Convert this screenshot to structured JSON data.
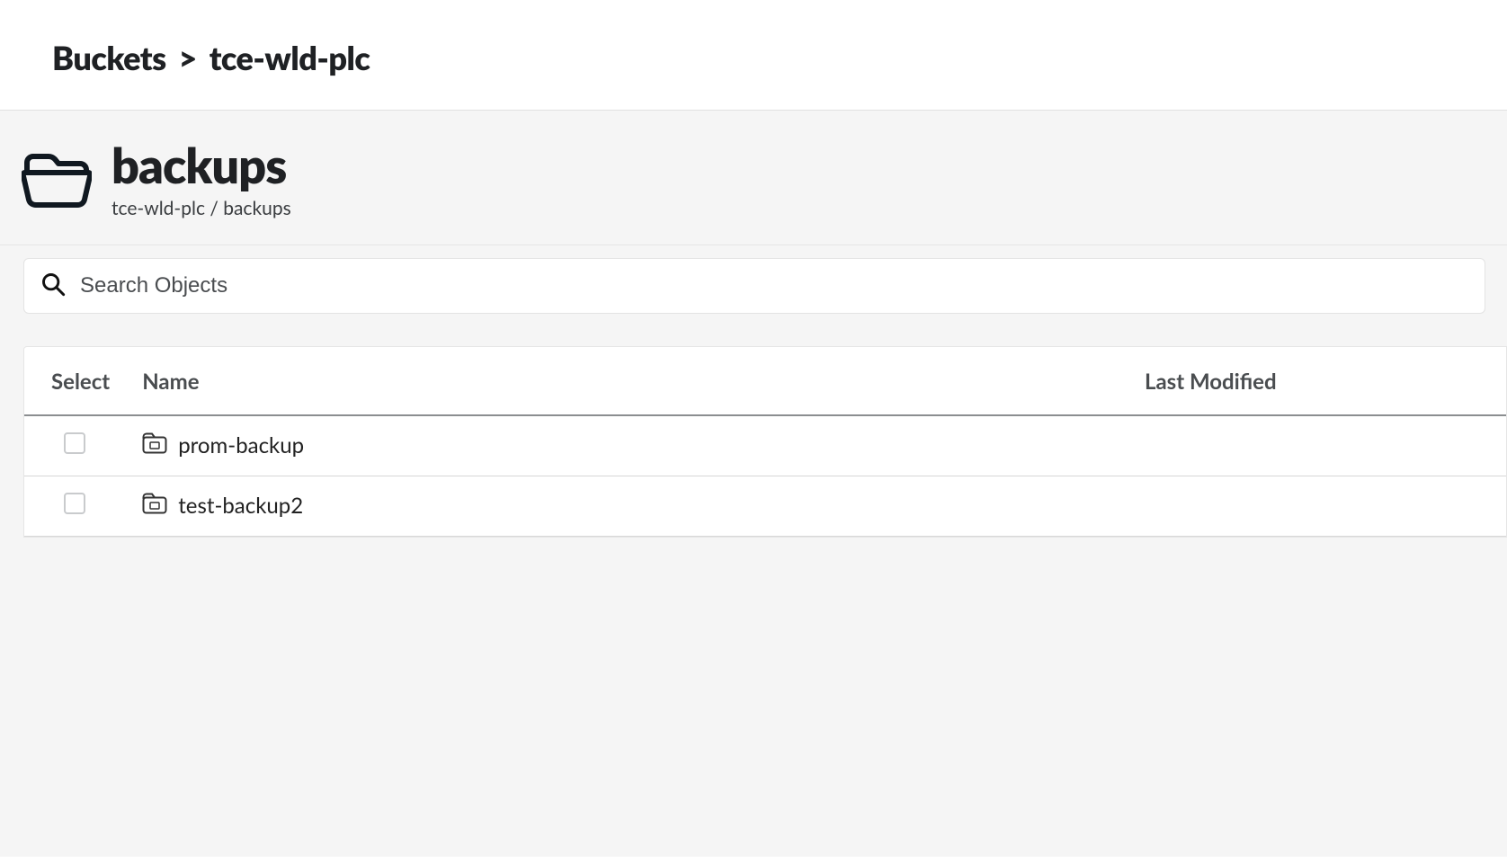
{
  "breadcrumb": {
    "root": "Buckets",
    "sep": ">",
    "leaf": "tce-wld-plc"
  },
  "header": {
    "title": "backups",
    "path": "tce-wld-plc / backups"
  },
  "search": {
    "placeholder": "Search Objects"
  },
  "table": {
    "cols": {
      "select": "Select",
      "name": "Name",
      "modified": "Last Modified"
    },
    "rows": [
      {
        "name": "prom-backup",
        "modified": ""
      },
      {
        "name": "test-backup2",
        "modified": ""
      }
    ]
  }
}
